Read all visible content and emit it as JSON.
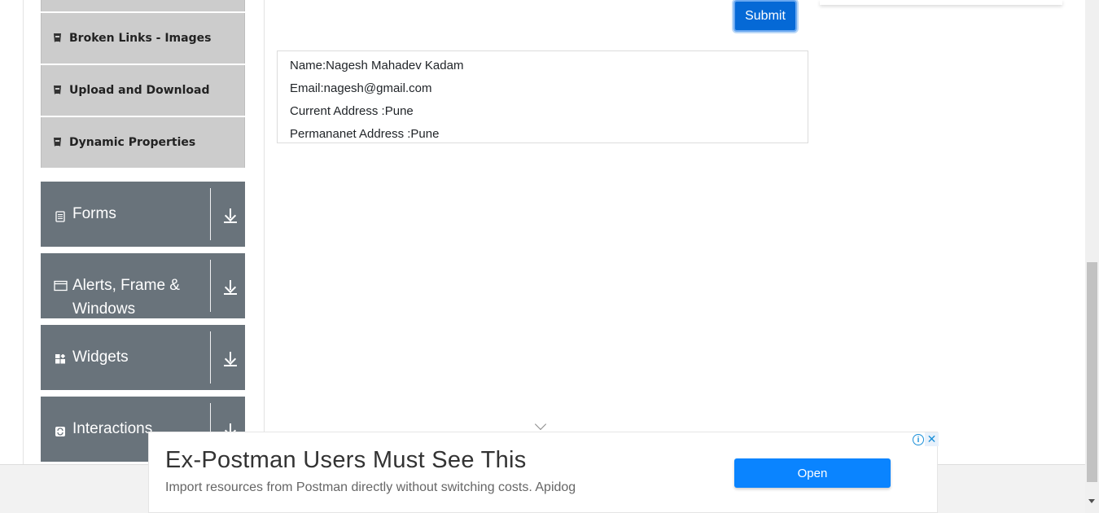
{
  "sidebar": {
    "sub_items": [
      {
        "label": "Broken Links - Images",
        "icon": "html5-icon"
      },
      {
        "label": "Upload and Download",
        "icon": "html5-icon"
      },
      {
        "label": "Dynamic Properties",
        "icon": "html5-icon"
      }
    ],
    "groups": [
      {
        "label": "Forms",
        "icon": "document-icon"
      },
      {
        "label": "Alerts, Frame & Windows",
        "icon": "window-icon"
      },
      {
        "label": "Widgets",
        "icon": "widgets-icon"
      },
      {
        "label": "Interactions",
        "icon": "interactions-icon"
      }
    ],
    "group_bg": "#69737b",
    "sub_bg": "#cccccc"
  },
  "form": {
    "submit_label": "Submit"
  },
  "output": {
    "name": "Name:Nagesh Mahadev Kadam",
    "email": "Email:nagesh@gmail.com",
    "current_address": "Current Address :Pune",
    "permanent_address": "Permananet Address :Pune"
  },
  "ad": {
    "title": "Ex-Postman Users Must See This",
    "description": "Import resources from Postman directly without switching costs. Apidog",
    "button_label": "Open",
    "info_glyph": "i",
    "close_glyph": "✕",
    "button_color": "#0a84ff"
  },
  "colors": {
    "accent": "#0569d6"
  }
}
